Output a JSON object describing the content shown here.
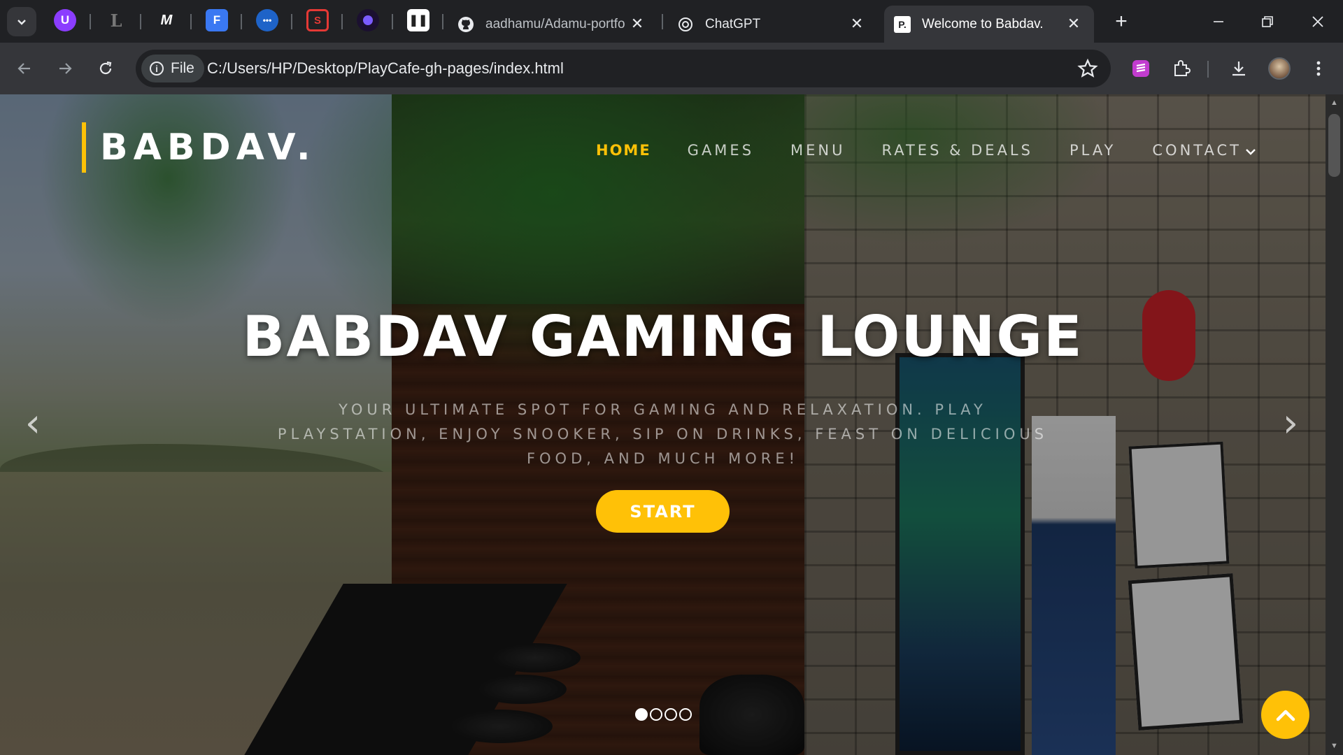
{
  "browser": {
    "tabs": [
      {
        "title": "aadhamu/Adamu-portfo",
        "icon": "github-icon"
      },
      {
        "title": "ChatGPT",
        "icon": "chatgpt-icon"
      },
      {
        "title": "Welcome to Babdav.",
        "icon": "site-favicon",
        "active": true
      }
    ],
    "address": {
      "scheme_chip": "File",
      "url": "C:/Users/HP/Desktop/PlayCafe-gh-pages/index.html"
    }
  },
  "site": {
    "logo": "BABDAV.",
    "nav": {
      "home": "HOME",
      "games": "GAMES",
      "menu": "MENU",
      "rates": "RATES & DEALS",
      "play": "PLAY",
      "contact": "CONTACT"
    },
    "hero": {
      "title": "BABDAV GAMING LOUNGE",
      "subtitle": "YOUR ULTIMATE SPOT FOR GAMING AND RELAXATION. PLAY PLAYSTATION, ENJOY SNOOKER, SIP ON DRINKS, FEAST ON DELICIOUS FOOD, AND MUCH MORE!",
      "button": "START",
      "prev": "‹",
      "next": "›",
      "slide_count": 4,
      "active_slide": 1
    },
    "accent": "#ffc107"
  }
}
